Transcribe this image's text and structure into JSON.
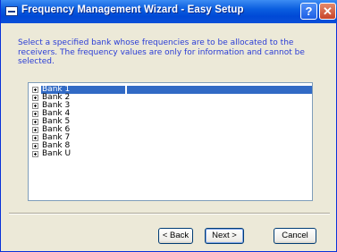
{
  "window": {
    "title": "Frequency Management Wizard - Easy Setup",
    "help_label": "?",
    "close_label": "✕"
  },
  "instructions": "Select a specified bank whose frequencies are to be allocated to the receivers. The frequency values are only for information and cannot be selected.",
  "tree": {
    "items": [
      {
        "label": "Bank 1",
        "selected": true
      },
      {
        "label": "Bank 2"
      },
      {
        "label": "Bank 3"
      },
      {
        "label": "Bank 4"
      },
      {
        "label": "Bank 5"
      },
      {
        "label": "Bank 6"
      },
      {
        "label": "Bank 7"
      },
      {
        "label": "Bank 8"
      },
      {
        "label": "Bank U"
      }
    ]
  },
  "buttons": {
    "back": "< Back",
    "next": "Next >",
    "cancel": "Cancel"
  },
  "colors": {
    "accent": "#316ac5",
    "instruction_text": "#2a3cd6",
    "titlebar": "#0a5ddf"
  }
}
